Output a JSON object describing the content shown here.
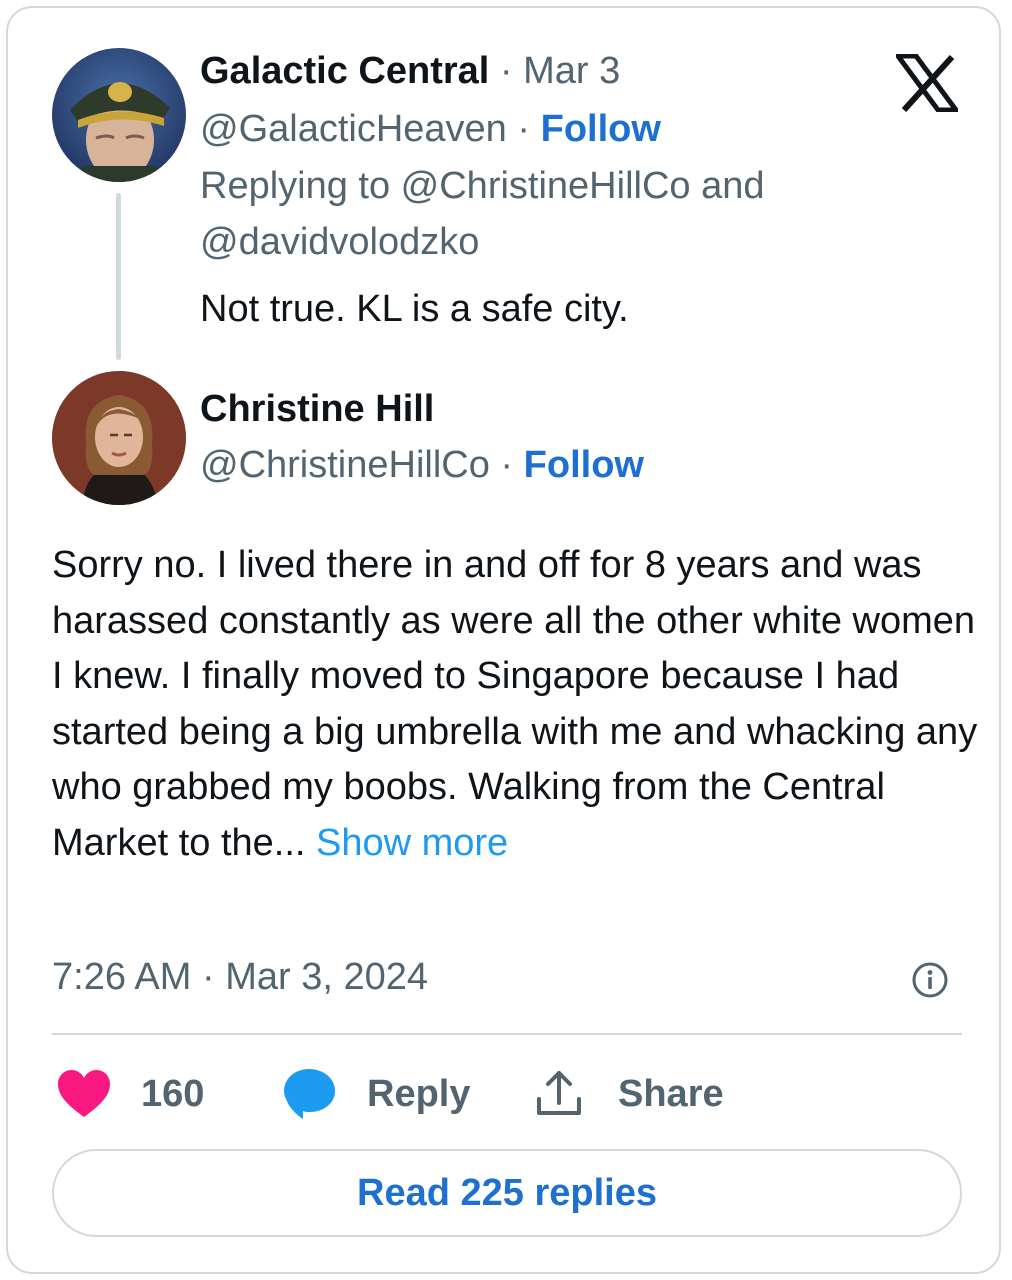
{
  "reply_tweet": {
    "display_name": "Galactic Central",
    "date_sep": " · ",
    "date": "Mar 3",
    "handle": "@GalacticHeaven",
    "follow_sep": " · ",
    "follow_label": "Follow",
    "replying_to_line1": "Replying to @ChristineHillCo and",
    "replying_to_line2": "@davidvolodzko",
    "text": "Not true. KL is a safe city."
  },
  "main_tweet": {
    "display_name": "Christine Hill",
    "handle": "@ChristineHillCo",
    "follow_sep": " · ",
    "follow_label": "Follow",
    "text": "Sorry no. I lived there in and off for 8 years and was harassed constantly as were all the other white women I knew. I finally moved to Singapore because I had started being a big umbrella with me and whacking any who grabbed my boobs. Walking from the Central Market to the... ",
    "show_more": "Show more",
    "timestamp": "7:26 AM · Mar 3, 2024"
  },
  "actions": {
    "like_count": "160",
    "reply_label": "Reply",
    "share_label": "Share"
  },
  "read_replies_label": "Read 225 replies",
  "icons": {
    "brand": "x-logo-icon",
    "info": "info-icon",
    "like": "heart-icon",
    "reply": "speech-bubble-icon",
    "share": "share-upload-icon"
  },
  "colors": {
    "follow": "#1d6fd1",
    "show_more": "#1d9bf0",
    "like": "#f91880",
    "reply": "#1d9bf0",
    "muted": "#536471",
    "border": "#cfd9de"
  }
}
